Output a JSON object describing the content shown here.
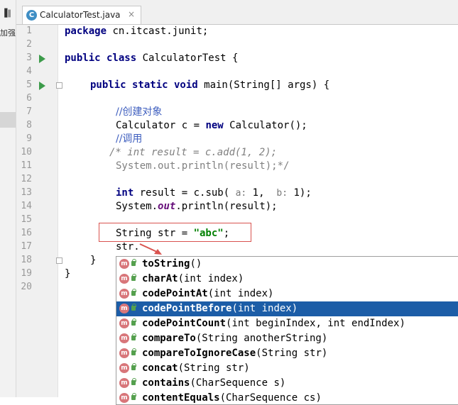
{
  "sidebar": {
    "glyph": "▐∥",
    "cn_text": "加强"
  },
  "tab": {
    "label": "CalculatorTest.java",
    "icon_letter": "C",
    "close": "×"
  },
  "line_numbers": [
    "1",
    "2",
    "3",
    "4",
    "5",
    "6",
    "7",
    "8",
    "9",
    "10",
    "11",
    "12",
    "13",
    "14",
    "15",
    "16",
    "17",
    "18",
    "19",
    "20"
  ],
  "code": {
    "l1_kw": "package",
    "l1_rest": " cn.itcast.junit;",
    "l3_kw": "public class",
    "l3_rest": " CalculatorTest {",
    "l5_kw": "public static void",
    "l5_rest": " main(String[] args) {",
    "l7_comment": "//创建对象",
    "l8_a": "Calculator c = ",
    "l8_kw": "new",
    "l8_b": " Calculator();",
    "l9_comment": "//调用",
    "l10_comment": "/* int result = c.add(1, 2);",
    "l11_comment": "System.out.println(result);*/",
    "l13_kw": "int",
    "l13_a": " result = c.sub( ",
    "l13_hint1": "a:",
    "l13_v1": " 1,  ",
    "l13_hint2": "b:",
    "l13_v2": " 1);",
    "l14_a": "System.",
    "l14_static": "out",
    "l14_b": ".println(result);",
    "l16_a": "String str = ",
    "l16_str": "\"abc\"",
    "l16_b": ";",
    "l17": "str.",
    "l18": "}",
    "l19": "}"
  },
  "completion": [
    {
      "name": "toString",
      "args": "()",
      "selected": false
    },
    {
      "name": "charAt",
      "args": "(int index)",
      "selected": false
    },
    {
      "name": "codePointAt",
      "args": "(int index)",
      "selected": false
    },
    {
      "name": "codePointBefore",
      "args": "(int index)",
      "selected": true
    },
    {
      "name": "codePointCount",
      "args": "(int beginIndex, int endIndex)",
      "selected": false
    },
    {
      "name": "compareTo",
      "args": "(String anotherString)",
      "selected": false
    },
    {
      "name": "compareToIgnoreCase",
      "args": "(String str)",
      "selected": false
    },
    {
      "name": "concat",
      "args": "(String str)",
      "selected": false
    },
    {
      "name": "contains",
      "args": "(CharSequence s)",
      "selected": false
    },
    {
      "name": "contentEquals",
      "args": "(CharSequence cs)",
      "selected": false
    }
  ],
  "completion_icon": {
    "letter": "m",
    "kind": "method-icon",
    "visibility": "public-lock-icon"
  },
  "colors": {
    "keyword": "#000080",
    "string": "#008000",
    "comment": "#808080",
    "selection": "#1c5da7",
    "highlight_box": "#d9534f",
    "run_icon": "#3c9b4a"
  }
}
